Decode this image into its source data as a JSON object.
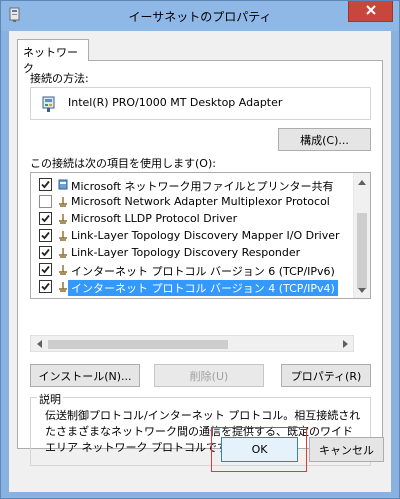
{
  "window": {
    "title": "イーサネットのプロパティ"
  },
  "tabs": [
    {
      "label": "ネットワーク",
      "active": true
    }
  ],
  "connect_using": {
    "label": "接続の方法:",
    "adapter": "Intel(R) PRO/1000 MT Desktop Adapter",
    "configure_button": "構成(C)..."
  },
  "items_section": {
    "label": "この接続は次の項目を使用します(O):",
    "items": [
      {
        "label": "Microsoft ネットワーク用ファイルとプリンター共有",
        "checked": true,
        "selected": false,
        "icon": "file-share-icon"
      },
      {
        "label": "Microsoft Network Adapter Multiplexor Protocol",
        "checked": false,
        "selected": false,
        "icon": "protocol-icon"
      },
      {
        "label": "Microsoft LLDP Protocol Driver",
        "checked": true,
        "selected": false,
        "icon": "protocol-icon"
      },
      {
        "label": "Link-Layer Topology Discovery Mapper I/O Driver",
        "checked": true,
        "selected": false,
        "icon": "protocol-icon"
      },
      {
        "label": "Link-Layer Topology Discovery Responder",
        "checked": true,
        "selected": false,
        "icon": "protocol-icon"
      },
      {
        "label": "インターネット プロトコル バージョン 6 (TCP/IPv6)",
        "checked": true,
        "selected": false,
        "icon": "protocol-icon"
      },
      {
        "label": "インターネット プロトコル バージョン 4 (TCP/IPv4)",
        "checked": true,
        "selected": true,
        "icon": "protocol-icon"
      }
    ]
  },
  "item_buttons": {
    "install": "インストール(N)...",
    "uninstall": "削除(U)",
    "properties": "プロパティ(R)"
  },
  "description": {
    "legend": "説明",
    "text": "伝送制御プロトコル/インターネット プロトコル。相互接続されたさまざまなネットワーク間の通信を提供する、既定のワイド エリア ネットワーク プロトコルです。"
  },
  "footer": {
    "ok": "OK",
    "cancel": "キャンセル"
  },
  "colors": {
    "title_bar": "#8fb8e6",
    "close_button": "#c7463d",
    "selection": "#3399ff",
    "ok_highlight": "#e03a3a"
  }
}
